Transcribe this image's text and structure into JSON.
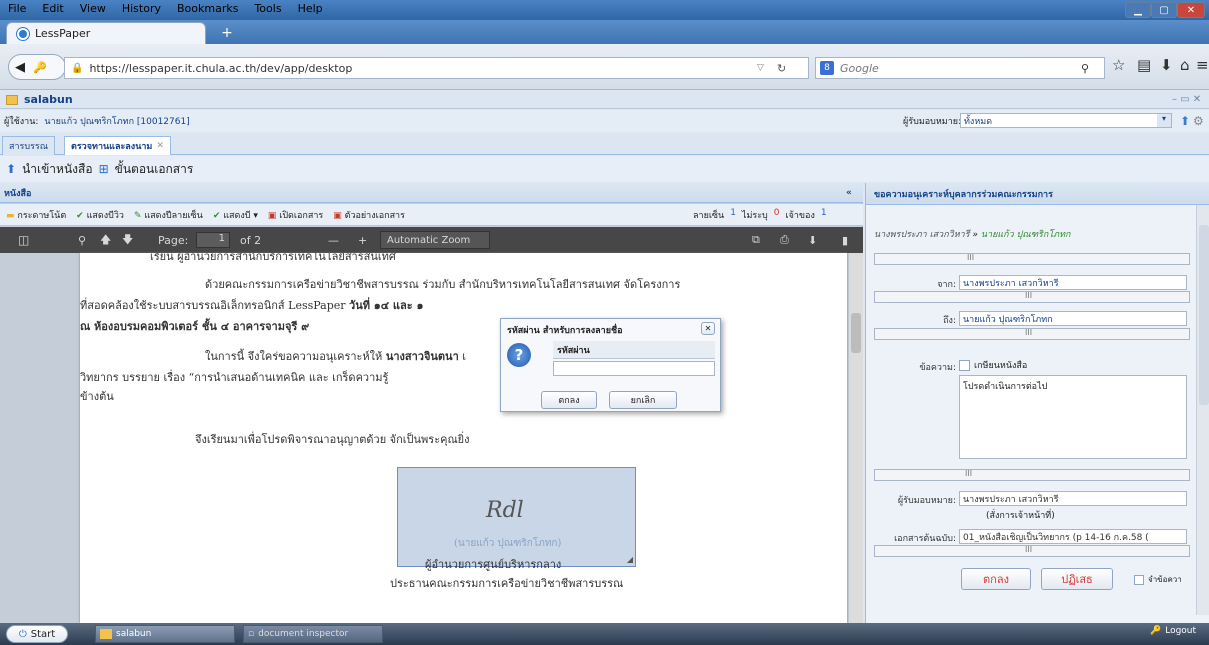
{
  "browser": {
    "menu": [
      "File",
      "Edit",
      "View",
      "History",
      "Bookmarks",
      "Tools",
      "Help"
    ],
    "tab_title": "LessPaper",
    "new_tab": "+",
    "url": "https://lesspaper.it.chula.ac.th/dev/app/desktop",
    "search_engine": "Google"
  },
  "app": {
    "title": "salabun",
    "user_label": "ผู้ใช้งาน:",
    "user_name": "นายแก้ว ปุณฑริกโภทก [10012761]",
    "assign_label": "ผู้รับมอบหมาย:",
    "assign_value": "ทั้งหมด",
    "tabs": [
      "สารบรรณ",
      "ตรวจทานและลงนาม"
    ],
    "toolbar": [
      "นำเข้าหนังสือ",
      "ขั้นตอนเอกสาร"
    ]
  },
  "left": {
    "header": "หนังสือ",
    "actions": [
      "กระดาษโน้ต",
      "แสดงบีวิว",
      "แสดงปีลายเซ็น",
      "แสดงบี",
      "เปิดเอกสาร",
      "ตัวอย่างเอกสาร"
    ],
    "stats": {
      "sign_label": "ลายเซ็น",
      "sign_count": "1",
      "read_label": "ไม่ระบุ",
      "read_count": "0",
      "owner_label": "เจ้าของ",
      "owner_count": "1"
    },
    "pdf": {
      "page_label": "Page:",
      "page": "1",
      "of": "of 2",
      "zoom": "Automatic Zoom",
      "minus": "—",
      "plus": "+"
    }
  },
  "doc": {
    "line0": "เรียน   ผู้อำนวยการสำนักบริการเทคโนโลยีสารสนเทศ",
    "p1a": "ด้วยคณะกรรมการเครือข่ายวิชาชีพสารบรรณ ร่วมกับ สำนักบริหารเทคโนโลยีสารสนเทศ จัดโครงการ",
    "p1b": "ที่สอดคล้องใช้ระบบสารบรรณอิเล็กทรอนิกส์ LessPaper",
    "p1b_bold": "วันที่ ๑๔ และ ๑",
    "p1c": "ณ ห้องอบรมคอมพิวเตอร์ ชั้น ๔ อาคารจามจุรี ๙",
    "p2a": "ในการนี้ จึงใคร่ขอความอนุเคราะห์ให้",
    "p2a_bold": "นางสาวจินตนา",
    "p2a_tail": "เ",
    "p2b": "วิทยากร บรรยาย เรื่อง “การนำเสนอด้านเทคนิค และ เกร็ดความรู้",
    "p2c": "ข้างต้น",
    "p3": "จึงเรียนมาเพื่อโปรดพิจารณาอนุญาตด้วย จักเป็นพระคุณยิ่ง",
    "signature": "Rdl",
    "sig_name": "(นายแก้ว  ปุณฑริกโภทก)",
    "sig_pos": "ผู้อำนวยการศูนย์บริหารกลาง",
    "sig_org": "ประธานคณะกรรมการเครือข่ายวิชาชีพสารบรรณ"
  },
  "dialog": {
    "title": "รหัสผ่าน สำหรับการลงลายชื่อ",
    "label": "รหัสผ่าน",
    "value": "",
    "ok": "ตกลง",
    "cancel": "ยกเลิก",
    "close": "✕"
  },
  "right": {
    "header": "ขอความอนุเคราะห์บุคลากรร่วมคณะกรรมการ",
    "route_from": "นางพรประภา เสวกวิหารี",
    "route_arrow": "»",
    "route_to": "นายแก้ว ปุณฑริกโภทก",
    "from_label": "จาก:",
    "from": "นางพรประภา เสวกวิหารี",
    "to_label": "ถึง:",
    "to": "นายแก้ว ปุณฑริกโภทก",
    "msg_label": "ข้อความ:",
    "msg_check": "เกษียนหนังสือ",
    "msg_text": "โปรดดำเนินการต่อไป",
    "assignee_label": "ผู้รับมอบหมาย:",
    "assignee": "นางพรประภา เสวกวิหารี",
    "assignee_role": "(สั่งการเจ้าหน้าที่)",
    "source_label": "เอกสารต้นฉบับ:",
    "source": "01_หนังสือเชิญเป็นวิทยากร (p 14-16 ก.ค.58 (",
    "ok": "ตกลง",
    "reject": "ปฏิเสธ",
    "remember": "จำข้อควา",
    "scroll_mark": "III"
  },
  "taskbar": {
    "start": "Start",
    "items": [
      "salabun",
      "document inspector"
    ],
    "logout": "Logout"
  }
}
